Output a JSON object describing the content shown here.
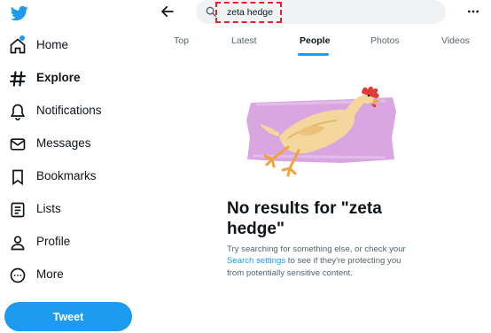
{
  "sidebar": {
    "items": [
      {
        "label": "Home",
        "icon": "home-icon"
      },
      {
        "label": "Explore",
        "icon": "hashtag-icon"
      },
      {
        "label": "Notifications",
        "icon": "bell-icon"
      },
      {
        "label": "Messages",
        "icon": "envelope-icon"
      },
      {
        "label": "Bookmarks",
        "icon": "bookmark-icon"
      },
      {
        "label": "Lists",
        "icon": "list-icon"
      },
      {
        "label": "Profile",
        "icon": "person-icon"
      },
      {
        "label": "More",
        "icon": "more-circle-icon"
      }
    ],
    "active": "Explore",
    "tweet_label": "Tweet"
  },
  "search": {
    "value": "zeta hedge"
  },
  "tabs": [
    {
      "label": "Top"
    },
    {
      "label": "Latest"
    },
    {
      "label": "People"
    },
    {
      "label": "Photos"
    },
    {
      "label": "Videos"
    }
  ],
  "active_tab": "People",
  "empty_state": {
    "title": "No results for \"zeta hedge\"",
    "desc_before": "Try searching for something else, or check your ",
    "link": "Search settings",
    "desc_after": " to see if they're protecting you from potentially sensitive content."
  },
  "colors": {
    "accent": "#1d9bf0",
    "highlight_border": "#e0262a",
    "illustration_bg": "#d9a6e2"
  }
}
